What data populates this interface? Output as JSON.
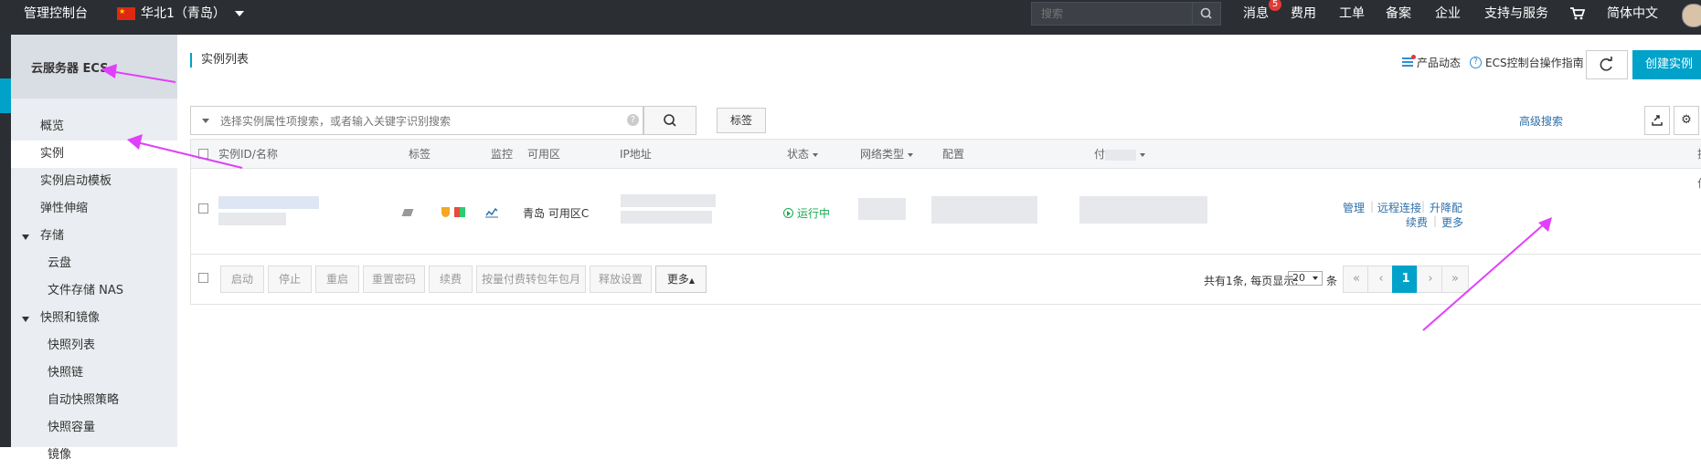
{
  "topbar": {
    "brand": "管理控制台",
    "region": "华北1（青岛）",
    "search_placeholder": "搜索",
    "menu": [
      "消息",
      "费用",
      "工单",
      "备案",
      "企业",
      "支持与服务",
      "简体中文"
    ],
    "message_badge": "5",
    "icons": {
      "search": "search-icon",
      "cart": "cart-icon",
      "flag": "china-flag-icon"
    }
  },
  "sidebar": {
    "header": "云服务器 ECS",
    "items": [
      {
        "label": "概览"
      },
      {
        "label": "实例",
        "active": true
      },
      {
        "label": "实例启动模板"
      },
      {
        "label": "弹性伸缩"
      },
      {
        "label": "存储",
        "group": true
      },
      {
        "label": "云盘"
      },
      {
        "label": "文件存储 NAS"
      },
      {
        "label": "快照和镜像",
        "group": true
      },
      {
        "label": "快照列表"
      },
      {
        "label": "快照链"
      },
      {
        "label": "自动快照策略"
      },
      {
        "label": "快照容量"
      },
      {
        "label": "镜像"
      }
    ]
  },
  "main": {
    "title": "实例列表",
    "product_news": "产品动态",
    "guide": "ECS控制台操作指南",
    "create_button": "创建实例",
    "search_placeholder": "选择实例属性项搜索，或者输入关键字识别搜索",
    "tag_button": "标签",
    "advanced_search": "高级搜索",
    "table": {
      "headers": [
        "实例ID/名称",
        "标签",
        "监控",
        "可用区",
        "IP地址",
        "状态",
        "网络类型",
        "配置",
        "付",
        "操作"
      ],
      "row": {
        "zone": "青岛 可用区C",
        "status": "运行中",
        "actions_line1": [
          "管理",
          "远程连接",
          "升降配"
        ],
        "actions_line2": [
          "续费",
          "更多"
        ]
      }
    },
    "footer": {
      "buttons": [
        "启动",
        "停止",
        "重启",
        "重置密码",
        "续费",
        "按量付费转包年包月",
        "释放设置",
        "更多"
      ],
      "total_text": "共有1条, 每页显示:",
      "page_size": "20",
      "unit": "条",
      "pages": [
        "«",
        "‹",
        "1",
        "›",
        "»"
      ],
      "current_page": "1"
    }
  },
  "colors": {
    "accent": "#00a2ca",
    "link": "#2f6fa8",
    "running": "#1aaa55",
    "annotation": "#e040fb"
  }
}
